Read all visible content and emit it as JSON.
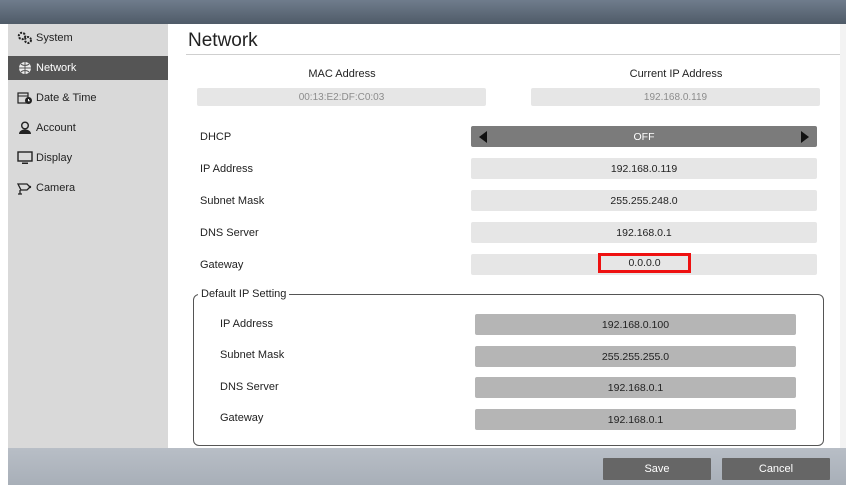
{
  "sidebar": {
    "items": [
      {
        "label": "System",
        "icon": "gears-icon"
      },
      {
        "label": "Network",
        "icon": "globe-network-icon"
      },
      {
        "label": "Date & Time",
        "icon": "calendar-clock-icon"
      },
      {
        "label": "Account",
        "icon": "user-icon"
      },
      {
        "label": "Display",
        "icon": "monitor-icon"
      },
      {
        "label": "Camera",
        "icon": "camera-icon"
      }
    ]
  },
  "page": {
    "title": "Network"
  },
  "info": {
    "mac_label": "MAC Address",
    "mac_value": "00:13:E2:DF:C0:03",
    "ip_label": "Current IP Address",
    "ip_value": "192.168.0.119"
  },
  "settings": {
    "dhcp_label": "DHCP",
    "dhcp_value": "OFF",
    "ip_label": "IP Address",
    "ip_value": "192.168.0.119",
    "subnet_label": "Subnet Mask",
    "subnet_value": "255.255.248.0",
    "dns_label": "DNS Server",
    "dns_value": "192.168.0.1",
    "gateway_label": "Gateway",
    "gateway_value": "0.0.0.0"
  },
  "default_ip": {
    "title": "Default IP Setting",
    "ip_label": "IP Address",
    "ip_value": "192.168.0.100",
    "subnet_label": "Subnet Mask",
    "subnet_value": "255.255.255.0",
    "dns_label": "DNS Server",
    "dns_value": "192.168.0.1",
    "gateway_label": "Gateway",
    "gateway_value": "192.168.0.1"
  },
  "footer": {
    "save_label": "Save",
    "cancel_label": "Cancel"
  },
  "colors": {
    "highlight": "#ee1111",
    "active_nav": "#555555"
  }
}
